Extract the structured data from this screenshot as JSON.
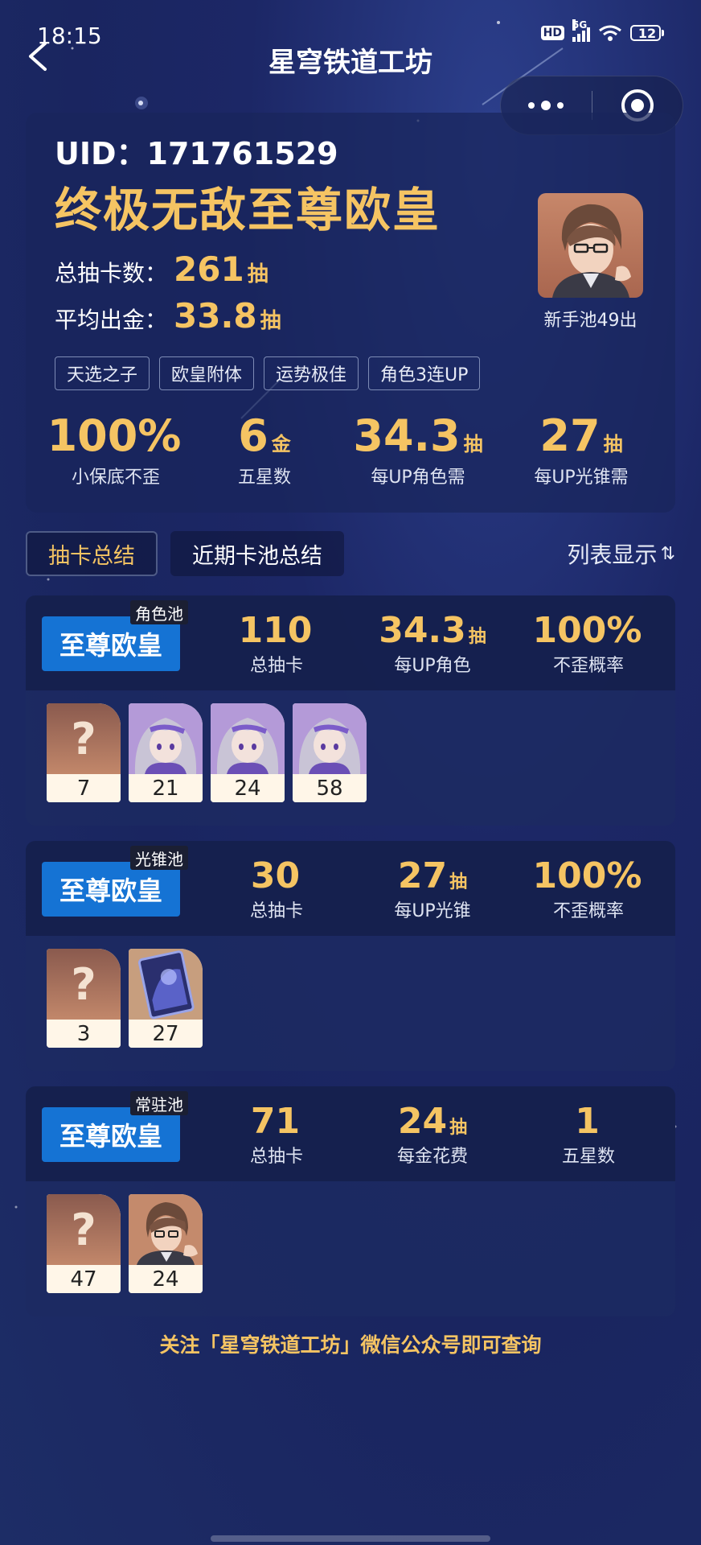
{
  "status_bar": {
    "time": "18:15",
    "hd": "HD",
    "network": "5G",
    "battery": "12",
    "signal_icon": "signal-icon",
    "wifi_icon": "wifi-icon",
    "battery_icon": "battery-icon",
    "battery_level": 0.12,
    "battery_color": "#e23b3b"
  },
  "nav": {
    "title": "星穹铁道工坊",
    "back_icon": "chevron-left-icon",
    "more_icon": "more-dots-icon",
    "close_icon": "target-close-icon"
  },
  "colors": {
    "accent_gold": "#f5c463",
    "rank_blue": "#1573d4",
    "background": "#1c2766"
  },
  "summary": {
    "uid_label": "UID：",
    "uid_value": "171761529",
    "rank_title": "终极无敌至尊欧皇",
    "total_pulls_label": "总抽卡数：",
    "total_pulls_value": "261",
    "avg_gold_label": "平均出金：",
    "avg_gold_value": "33.8",
    "pull_unit": "抽",
    "avatar_caption": "新手池49出",
    "tags": [
      "天选之子",
      "欧皇附体",
      "运势极佳",
      "角色3连UP"
    ],
    "big_stats": [
      {
        "value": "100%",
        "unit": "",
        "label": "小保底不歪"
      },
      {
        "value": "6",
        "unit": "金",
        "label": "五星数"
      },
      {
        "value": "34.3",
        "unit": "抽",
        "label": "每UP角色需"
      },
      {
        "value": "27",
        "unit": "抽",
        "label": "每UP光锥需"
      }
    ]
  },
  "tabs": {
    "summary": "抽卡总结",
    "recent": "近期卡池总结",
    "list_toggle": "列表显示",
    "sort_icon_glyph": "⇅",
    "sort_icon": "sort-icon"
  },
  "pools": [
    {
      "tag": "角色池",
      "rank": "至尊欧皇",
      "stats": [
        {
          "value": "110",
          "unit": "",
          "label": "总抽卡"
        },
        {
          "value": "34.3",
          "unit": "抽",
          "label": "每UP角色"
        },
        {
          "value": "100%",
          "unit": "",
          "label": "不歪概率"
        }
      ],
      "items": [
        {
          "art": "unknown",
          "glyph": "?",
          "count": "7"
        },
        {
          "art": "character-silver-hair",
          "count": "21"
        },
        {
          "art": "character-silver-hair",
          "count": "24"
        },
        {
          "art": "character-silver-hair",
          "count": "58"
        }
      ]
    },
    {
      "tag": "光锥池",
      "rank": "至尊欧皇",
      "stats": [
        {
          "value": "30",
          "unit": "",
          "label": "总抽卡"
        },
        {
          "value": "27",
          "unit": "抽",
          "label": "每UP光锥"
        },
        {
          "value": "100%",
          "unit": "",
          "label": "不歪概率"
        }
      ],
      "items": [
        {
          "art": "unknown",
          "glyph": "?",
          "count": "3"
        },
        {
          "art": "light-cone",
          "count": "27"
        }
      ]
    },
    {
      "tag": "常驻池",
      "rank": "至尊欧皇",
      "stats": [
        {
          "value": "71",
          "unit": "",
          "label": "总抽卡"
        },
        {
          "value": "24",
          "unit": "抽",
          "label": "每金花费"
        },
        {
          "value": "1",
          "unit": "",
          "label": "五星数"
        }
      ],
      "items": [
        {
          "art": "unknown",
          "glyph": "?",
          "count": "47"
        },
        {
          "art": "character-glasses",
          "count": "24"
        }
      ]
    }
  ],
  "footer": "关注「星穹铁道工坊」微信公众号即可查询"
}
